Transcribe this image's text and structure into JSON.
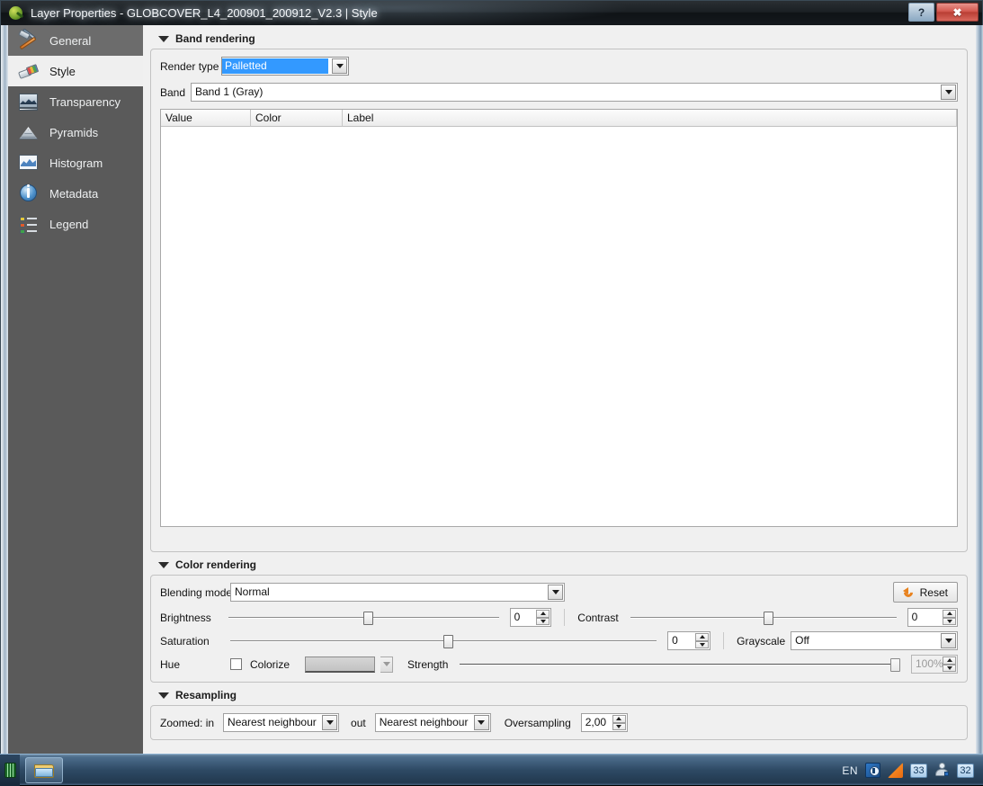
{
  "window": {
    "title": "Layer Properties - GLOBCOVER_L4_200901_200912_V2.3 | Style",
    "app_icon": "qgis-icon",
    "help_button": "?",
    "close_button": "✖"
  },
  "sidebar": {
    "items": [
      {
        "label": "General",
        "icon": "hammer-wrench-icon",
        "selected": false
      },
      {
        "label": "Style",
        "icon": "paintbrush-icon",
        "selected": true
      },
      {
        "label": "Transparency",
        "icon": "transparency-icon",
        "selected": false
      },
      {
        "label": "Pyramids",
        "icon": "pyramids-icon",
        "selected": false
      },
      {
        "label": "Histogram",
        "icon": "histogram-icon",
        "selected": false
      },
      {
        "label": "Metadata",
        "icon": "info-circle-icon",
        "selected": false
      },
      {
        "label": "Legend",
        "icon": "legend-swatches-icon",
        "selected": false
      }
    ]
  },
  "band_rendering": {
    "title": "Band rendering",
    "render_type_label": "Render type",
    "render_type_value": "Palletted",
    "band_label": "Band",
    "band_value": "Band 1 (Gray)",
    "table": {
      "columns": [
        "Value",
        "Color",
        "Label"
      ],
      "rows": []
    }
  },
  "color_rendering": {
    "title": "Color rendering",
    "blending_mode_label": "Blending mode",
    "blending_mode_value": "Normal",
    "brightness_label": "Brightness",
    "brightness_value": "0",
    "contrast_label": "Contrast",
    "contrast_value": "0",
    "saturation_label": "Saturation",
    "saturation_value": "0",
    "grayscale_label": "Grayscale",
    "grayscale_value": "Off",
    "hue_label": "Hue",
    "colorize_label": "Colorize",
    "colorize_checked": false,
    "strength_label": "Strength",
    "strength_value": "100%",
    "reset_label": "Reset",
    "reset_icon": "undo-arrow-icon"
  },
  "resampling": {
    "title": "Resampling",
    "zoomed_in_label": "Zoomed: in",
    "zoomed_in_value": "Nearest neighbour",
    "zoomed_out_label": "out",
    "zoomed_out_value": "Nearest neighbour",
    "oversampling_label": "Oversampling",
    "oversampling_value": "2,00"
  },
  "taskbar": {
    "start_icon": "start-orb-icon",
    "buttons": [
      {
        "icon": "folder-explorer-icon",
        "label": ""
      }
    ],
    "tray": {
      "language": "EN",
      "badge_1": "33",
      "badge_2": "32",
      "icons": [
        "blue-disk-icon",
        "orange-swoosh-icon",
        "person-search-icon"
      ]
    }
  },
  "colors": {
    "accent_selection": "#3399ff",
    "titlebar_dark": "#15191d",
    "sidebar_bg": "#5a5a5a",
    "dialog_bg": "#f0f0f0",
    "reset_orange": "#e8821e",
    "close_red": "#b93e34"
  }
}
